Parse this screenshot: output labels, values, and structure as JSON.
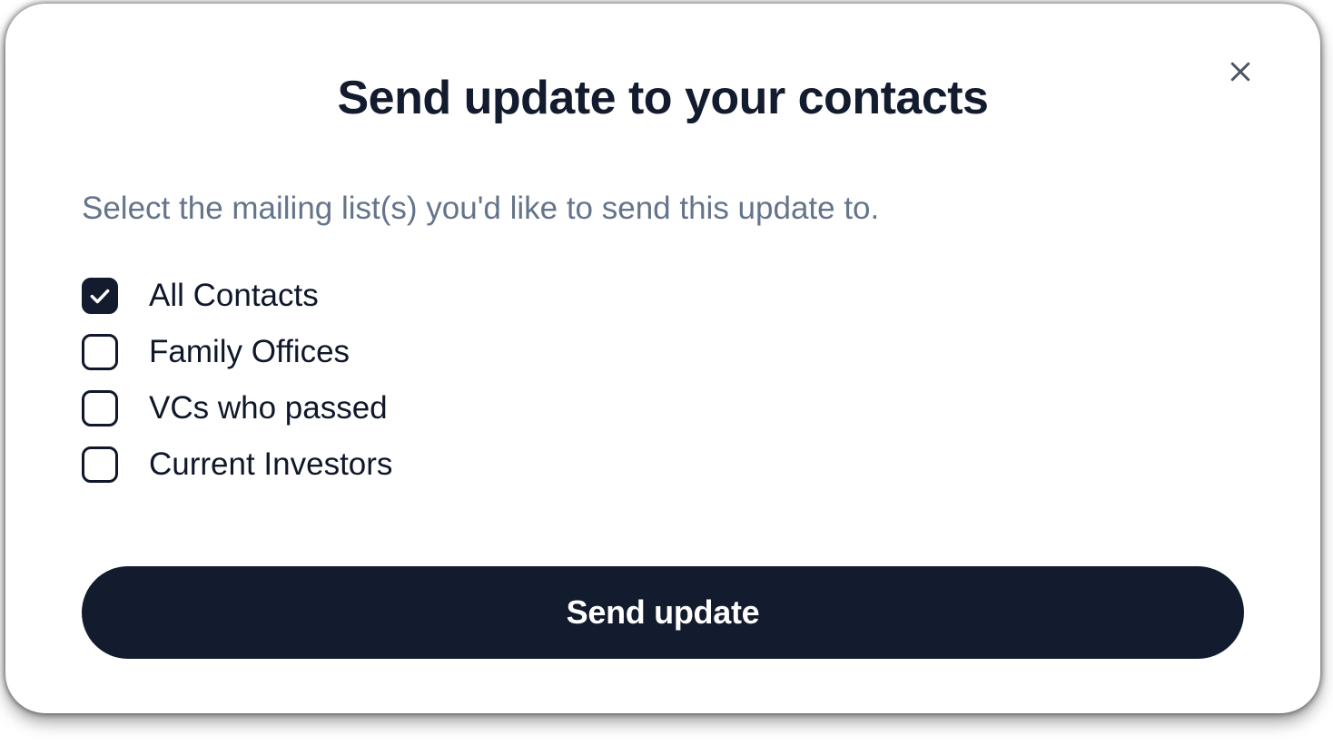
{
  "modal": {
    "title": "Send update to your contacts",
    "subtitle": "Select the mailing list(s) you'd like to send this update to.",
    "lists": [
      {
        "label": "All Contacts",
        "checked": true
      },
      {
        "label": "Family Offices",
        "checked": false
      },
      {
        "label": "VCs who passed",
        "checked": false
      },
      {
        "label": "Current Investors",
        "checked": false
      }
    ],
    "submit_label": "Send update"
  }
}
